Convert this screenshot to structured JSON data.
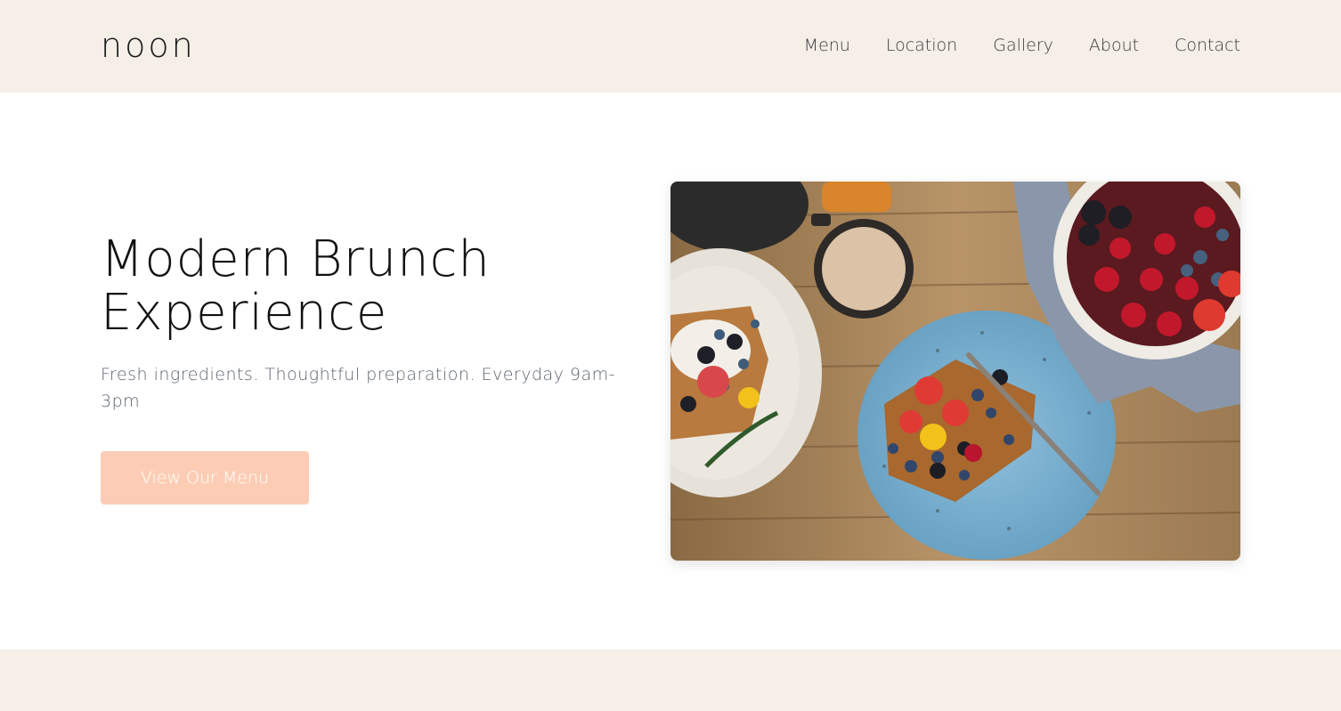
{
  "brand": {
    "logo_text": "noon"
  },
  "nav": {
    "items": [
      {
        "label": "Menu"
      },
      {
        "label": "Location"
      },
      {
        "label": "Gallery"
      },
      {
        "label": "About"
      },
      {
        "label": "Contact"
      }
    ]
  },
  "hero": {
    "title_line1": "Modern Brunch",
    "title_line2": "Experience",
    "subtitle": "Fresh ingredients. Thoughtful preparation. Everyday 9am-3pm",
    "cta_label": "View Our Menu",
    "image_icon": "brunch-photo"
  },
  "colors": {
    "header_bg": "#f5efe8",
    "cta_bg": "#fccdb4",
    "text_dark": "#111111",
    "text_muted": "#5d6670"
  }
}
